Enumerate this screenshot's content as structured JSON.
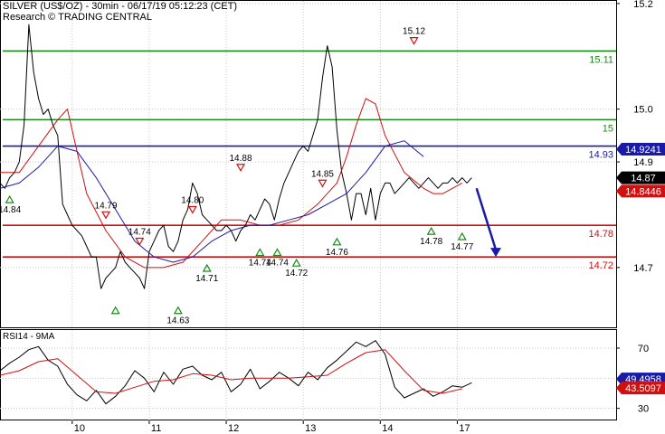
{
  "header": {
    "title": "SILVER (US$/OZ) - 30min - 06/17/19 05:12:23 (CET)",
    "research": "Research © TRADING CENTRAL"
  },
  "rsi_panel": {
    "title": "RSI14 - 9MA"
  },
  "chart_data": {
    "type": "line",
    "price_axis": {
      "ylim": [
        14.585,
        15.205
      ],
      "ticks": [
        14.7,
        14.9,
        15.0,
        15.2
      ],
      "tick_labels": [
        "14.7",
        "14.9",
        "15.0",
        "15.2"
      ]
    },
    "rsi_axis": {
      "ylim": [
        22,
        82
      ],
      "ticks": [
        30,
        50,
        70
      ],
      "tick_labels": [
        "30",
        "50",
        "70"
      ]
    },
    "x_axis": {
      "xlim": [
        0,
        64
      ],
      "ticks": [
        7.5,
        15.5,
        23.5,
        31.5,
        39.5,
        47.5
      ],
      "tick_labels": [
        "10",
        "11",
        "12",
        "13",
        "14",
        "17"
      ]
    },
    "levels": [
      {
        "value": 15.11,
        "label": "15.11",
        "color": "#1a8a1a"
      },
      {
        "value": 14.98,
        "label": "15",
        "color": "#1a8a1a"
      },
      {
        "value": 14.93,
        "label": "14.93",
        "color": "#1a1aa8"
      },
      {
        "value": 14.78,
        "label": "14.78",
        "color": "#d01010"
      },
      {
        "value": 14.72,
        "label": "14.72",
        "color": "#d01010"
      }
    ],
    "price_tags": [
      {
        "value": 14.9241,
        "label": "14.9241",
        "bg": "#1a1aa8",
        "fg": "#ffffff"
      },
      {
        "value": 14.87,
        "label": "14.87",
        "bg": "#000000",
        "fg": "#ffffff"
      },
      {
        "value": 14.8446,
        "label": "14.8446",
        "bg": "#d01010",
        "fg": "#ffffff"
      }
    ],
    "rsi_tags": [
      {
        "value": 49.4958,
        "label": "49.4958",
        "bg": "#1a1aa8",
        "fg": "#ffffff"
      },
      {
        "value": 43.5097,
        "label": "43.5097",
        "bg": "#d01010",
        "fg": "#ffffff"
      }
    ],
    "series": [
      {
        "name": "price",
        "color": "#000000",
        "x": [
          0,
          0.5,
          1,
          1.5,
          2,
          2.5,
          3,
          3.5,
          4,
          4.5,
          5,
          5.5,
          6,
          6.5,
          7,
          7.5,
          8,
          8.5,
          9,
          9.5,
          10,
          10.5,
          11,
          11.5,
          12,
          12.5,
          13,
          13.5,
          14,
          14.5,
          15,
          15.5,
          16,
          16.5,
          17,
          17.5,
          18,
          18.5,
          19,
          19.5,
          20,
          20.5,
          21,
          21.5,
          22,
          22.5,
          23,
          23.5,
          24,
          24.5,
          25,
          25.5,
          26,
          26.5,
          27,
          27.5,
          28,
          28.5,
          29,
          29.5,
          30,
          30.5,
          31,
          31.5,
          32,
          32.5,
          33,
          33.5,
          34,
          34.5,
          35,
          35.5,
          36,
          36.5,
          37,
          37.5,
          38,
          38.5,
          39,
          39.5,
          40,
          40.5,
          41,
          41.5,
          42,
          42.5,
          43,
          43.5,
          44,
          44.5,
          45,
          45.5,
          46,
          46.5,
          47,
          47.5,
          48,
          48.5,
          49
        ],
        "y": [
          14.86,
          14.85,
          14.87,
          14.88,
          14.9,
          14.97,
          15.16,
          15.07,
          15.02,
          14.99,
          15.0,
          14.97,
          14.95,
          14.82,
          14.8,
          14.78,
          14.77,
          14.76,
          14.74,
          14.72,
          14.72,
          14.66,
          14.68,
          14.69,
          14.7,
          14.73,
          14.71,
          14.7,
          14.69,
          14.68,
          14.66,
          14.73,
          14.75,
          14.77,
          14.78,
          14.74,
          14.73,
          14.75,
          14.79,
          14.81,
          14.86,
          14.84,
          14.8,
          14.79,
          14.78,
          14.77,
          14.77,
          14.78,
          14.77,
          14.75,
          14.77,
          14.78,
          14.8,
          14.79,
          14.81,
          14.83,
          14.82,
          14.79,
          14.83,
          14.86,
          14.88,
          14.9,
          14.92,
          14.93,
          14.92,
          14.95,
          14.98,
          15.06,
          15.12,
          15.08,
          14.96,
          14.88,
          14.84,
          14.79,
          14.84,
          14.84,
          14.8,
          14.85,
          14.79,
          14.84,
          14.86,
          14.86,
          14.84,
          14.85,
          14.86,
          14.87,
          14.86,
          14.85,
          14.86,
          14.87,
          14.86,
          14.85,
          14.86,
          14.86,
          14.87,
          14.86,
          14.87,
          14.86,
          14.87
        ]
      },
      {
        "name": "ma-red",
        "color": "#d01010",
        "x": [
          0,
          2,
          4,
          6,
          7,
          8,
          9,
          11,
          13,
          15,
          17,
          19,
          21,
          23,
          25,
          27,
          29,
          31,
          33,
          35,
          36,
          37,
          38,
          39,
          40,
          42,
          44,
          45,
          46,
          47,
          48
        ],
        "y": [
          14.88,
          14.88,
          14.93,
          14.98,
          15.0,
          14.92,
          14.84,
          14.77,
          14.72,
          14.7,
          14.7,
          14.71,
          14.75,
          14.79,
          14.79,
          14.78,
          14.78,
          14.79,
          14.82,
          14.86,
          14.91,
          14.97,
          15.02,
          15.01,
          14.95,
          14.88,
          14.85,
          14.84,
          14.84,
          14.85,
          14.86
        ]
      },
      {
        "name": "ma-blue",
        "color": "#1a1aa8",
        "x": [
          0,
          2,
          4,
          6,
          8,
          10,
          12,
          14,
          16,
          18,
          20,
          22,
          24,
          26,
          28,
          30,
          32,
          34,
          36,
          38,
          40,
          42,
          44
        ],
        "y": [
          14.85,
          14.86,
          14.89,
          14.93,
          14.92,
          14.87,
          14.81,
          14.75,
          14.72,
          14.71,
          14.72,
          14.75,
          14.77,
          14.78,
          14.78,
          14.79,
          14.8,
          14.82,
          14.84,
          14.88,
          14.93,
          14.94,
          14.91
        ]
      },
      {
        "name": "rsi",
        "color": "#000000",
        "x": [
          0,
          1,
          2,
          3,
          4,
          5,
          6,
          7,
          8,
          9,
          10,
          11,
          12,
          13,
          14,
          15,
          16,
          17,
          18,
          19,
          20,
          21,
          22,
          23,
          24,
          25,
          26,
          27,
          28,
          29,
          30,
          31,
          32,
          33,
          34,
          35,
          36,
          37,
          38,
          39,
          40,
          41,
          42,
          43,
          44,
          45,
          46,
          47,
          48,
          49
        ],
        "y": [
          55,
          60,
          64,
          69,
          71,
          62,
          58,
          46,
          39,
          35,
          42,
          33,
          38,
          45,
          55,
          50,
          41,
          54,
          46,
          56,
          58,
          52,
          49,
          54,
          41,
          46,
          56,
          43,
          48,
          54,
          50,
          45,
          54,
          49,
          57,
          62,
          68,
          74,
          71,
          75,
          66,
          44,
          37,
          40,
          43,
          38,
          41,
          45,
          44,
          47
        ]
      },
      {
        "name": "rsi-ma",
        "color": "#d01010",
        "x": [
          0,
          2,
          4,
          6,
          8,
          10,
          12,
          14,
          16,
          18,
          20,
          22,
          24,
          26,
          28,
          30,
          32,
          34,
          36,
          38,
          40,
          42,
          44,
          46,
          48
        ],
        "y": [
          52,
          55,
          61,
          63,
          52,
          41,
          40,
          44,
          48,
          49,
          53,
          52,
          49,
          50,
          50,
          50,
          51,
          52,
          60,
          67,
          69,
          55,
          42,
          40,
          43
        ]
      }
    ],
    "annotations": [
      {
        "x": 1.0,
        "y": 14.84,
        "label": "14.84",
        "type": "low"
      },
      {
        "x": 11.0,
        "y": 14.79,
        "label": "14.79",
        "type": "high"
      },
      {
        "x": 14.5,
        "y": 14.74,
        "label": "14.74",
        "type": "high"
      },
      {
        "x": 12.0,
        "y": 14.63,
        "label": "",
        "type": "low"
      },
      {
        "x": 18.5,
        "y": 14.63,
        "label": "14.63",
        "type": "low"
      },
      {
        "x": 20.0,
        "y": 14.8,
        "label": "14.80",
        "type": "high"
      },
      {
        "x": 21.5,
        "y": 14.71,
        "label": "14.71",
        "type": "low"
      },
      {
        "x": 25.0,
        "y": 14.88,
        "label": "14.88",
        "type": "high"
      },
      {
        "x": 27.0,
        "y": 14.74,
        "label": "14.74",
        "type": "low"
      },
      {
        "x": 28.8,
        "y": 14.74,
        "label": "14.74",
        "type": "low"
      },
      {
        "x": 30.8,
        "y": 14.72,
        "label": "14.72",
        "type": "low"
      },
      {
        "x": 33.5,
        "y": 14.85,
        "label": "14.85",
        "type": "high"
      },
      {
        "x": 35.0,
        "y": 14.76,
        "label": "14.76",
        "type": "low"
      },
      {
        "x": 43.0,
        "y": 15.12,
        "label": "15.12",
        "type": "high"
      },
      {
        "x": 44.8,
        "y": 14.78,
        "label": "14.78",
        "type": "low"
      },
      {
        "x": 48.0,
        "y": 14.77,
        "label": "14.77",
        "type": "low"
      }
    ],
    "forecast_arrow": {
      "from": {
        "x": 49.5,
        "y": 14.85
      },
      "to": {
        "x": 51.5,
        "y": 14.72
      },
      "color": "#1a1aa8"
    },
    "grid": true
  }
}
